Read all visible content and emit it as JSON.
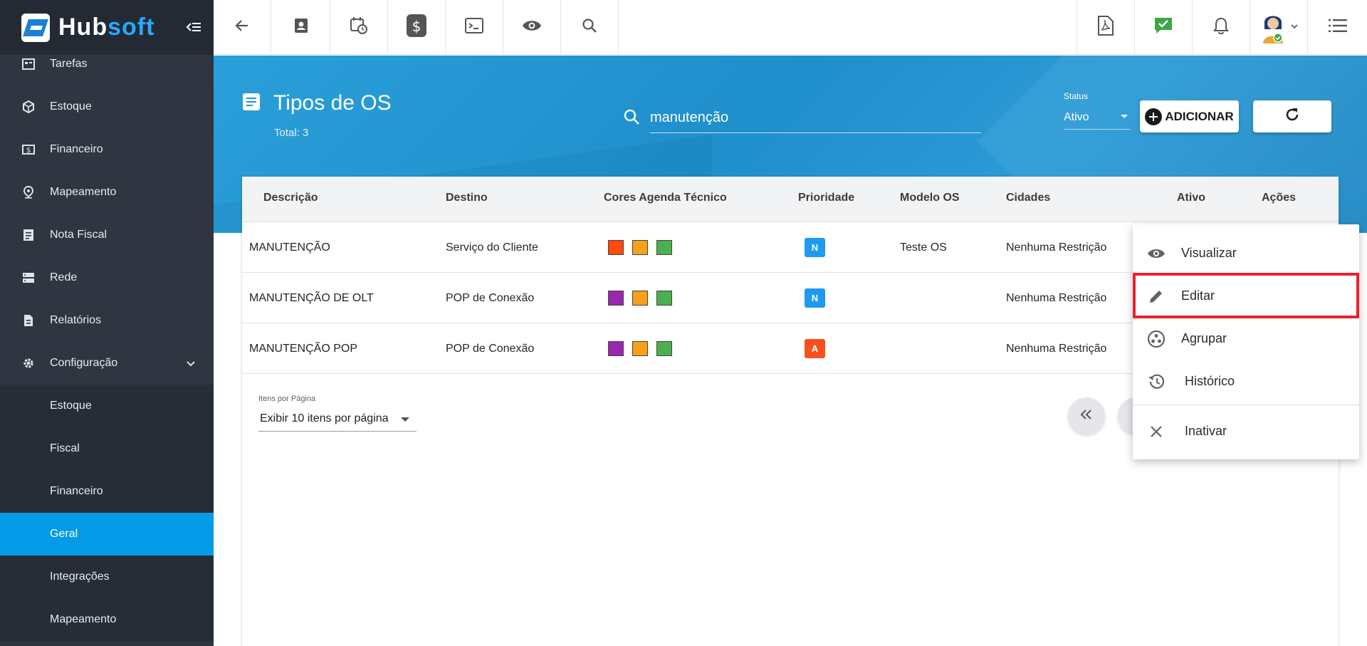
{
  "brand": {
    "part1": "Hub",
    "part2": "soft"
  },
  "sidebar": {
    "items": [
      {
        "label": "Tarefas",
        "icon": "tasks-icon"
      },
      {
        "label": "Estoque",
        "icon": "box-icon"
      },
      {
        "label": "Financeiro",
        "icon": "money-icon"
      },
      {
        "label": "Mapeamento",
        "icon": "map-pin-icon"
      },
      {
        "label": "Nota Fiscal",
        "icon": "invoice-icon"
      },
      {
        "label": "Rede",
        "icon": "server-icon"
      },
      {
        "label": "Relatórios",
        "icon": "report-icon"
      },
      {
        "label": "Configuração",
        "icon": "gear-icon"
      }
    ],
    "subitems": [
      {
        "label": "Estoque"
      },
      {
        "label": "Fiscal"
      },
      {
        "label": "Financeiro"
      },
      {
        "label": "Geral"
      },
      {
        "label": "Integrações"
      },
      {
        "label": "Mapeamento"
      }
    ],
    "active_subitem": "Geral"
  },
  "header": {
    "title": "Tipos de OS",
    "total": "Total: 3",
    "search_value": "manutenção",
    "status_label": "Status",
    "status_value": "Ativo",
    "add_label": "ADICIONAR"
  },
  "table": {
    "columns": [
      "Descrição",
      "Destino",
      "Cores Agenda Técnico",
      "Prioridade",
      "Modelo OS",
      "Cidades",
      "Ativo",
      "Ações"
    ],
    "rows": [
      {
        "descricao": "MANUTENÇÃO",
        "destino": "Serviço do Cliente",
        "cores": [
          "#ff4a0c",
          "#f7a11a",
          "#4caf50"
        ],
        "prioridade": "N",
        "prioridade_color": "#1e9af0",
        "modelo": "Teste OS",
        "cidades": "Nenhuma Restrição"
      },
      {
        "descricao": "MANUTENÇÃO DE OLT",
        "destino": "POP de Conexão",
        "cores": [
          "#9c27b0",
          "#f7a11a",
          "#4caf50"
        ],
        "prioridade": "N",
        "prioridade_color": "#1e9af0",
        "modelo": "",
        "cidades": "Nenhuma Restrição"
      },
      {
        "descricao": "MANUTENÇÃO POP",
        "destino": "POP de Conexão",
        "cores": [
          "#9c27b0",
          "#f7a11a",
          "#4caf50"
        ],
        "prioridade": "A",
        "prioridade_color": "#f4511e",
        "modelo": "",
        "cidades": "Nenhuma Restrição"
      }
    ]
  },
  "pagination": {
    "items_label": "Itens por Página",
    "items_value": "Exibir 10 itens por página"
  },
  "menu": {
    "items": [
      {
        "label": "Visualizar",
        "icon": "eye-icon"
      },
      {
        "label": "Editar",
        "icon": "pencil-icon",
        "highlighted": true
      },
      {
        "label": "Agrupar",
        "icon": "group-icon"
      },
      {
        "label": "Histórico",
        "icon": "history-icon"
      },
      {
        "label": "Inativar",
        "icon": "close-icon"
      }
    ]
  },
  "colors": {
    "sidebar_bg": "#2f3641",
    "active_bg": "#039be5",
    "band_bg": "#2192cf",
    "highlight": "#e8232f"
  }
}
